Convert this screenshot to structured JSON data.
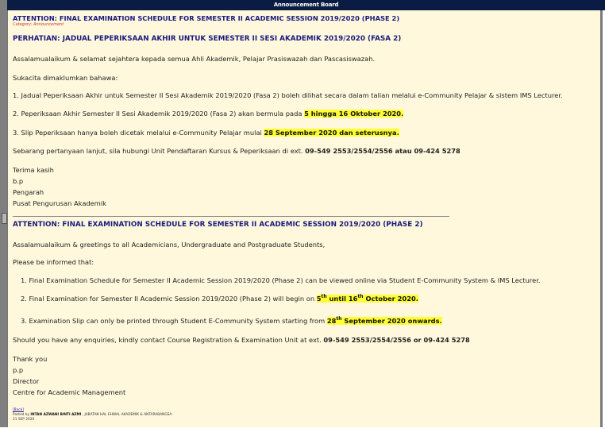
{
  "board_title": "Announcement Board",
  "category": "Category: Announcement",
  "heading": "ATTENTION: FINAL EXAMINATION SCHEDULE FOR SEMESTER II ACADEMIC SESSION 2019/2020 (PHASE 2)",
  "malay": {
    "title": "PERHATIAN: JADUAL PEPERIKSAAN AKHIR UNTUK SEMESTER II SESI AKADEMIK 2019/2020 (FASA 2)",
    "greeting": "Assalamualaikum & selamat sejahtera kepada semua Ahli Akademik, Pelajar Prasiswazah dan Pascasiswazah.",
    "intro": "Sukacita dimaklumkan bahawa:",
    "item1": "1. Jadual Peperiksaan Akhir untuk Semester II Sesi Akademik 2019/2020 (Fasa 2) boleh dilihat secara dalam talian melalui e-Community Pelajar & sistem IMS Lecturer.",
    "item2_pre": "2. Peperiksaan Akhir Semester II Sesi Akademik 2019/2020 (Fasa 2) akan bermula pada ",
    "item2_hl": "5 hingga 16 Oktober 2020.",
    "item3_pre": "3. Slip Peperiksaan hanya boleh dicetak melalui e-Community Pelajar mulai ",
    "item3_hl": "28 September 2020 dan seterusnya.",
    "contact_pre": "Sebarang pertanyaan lanjut, sila hubungi Unit Pendaftaran Kursus & Peperiksaan di ext. ",
    "contact_num": "09-549 2553/2554/2556 atau 09-424 5278",
    "thanks": "Terima kasih",
    "bp": "b.p",
    "role": "Pengarah",
    "dept": "Pusat Pengurusan Akademik"
  },
  "english": {
    "title": "ATTENTION: FINAL EXAMINATION SCHEDULE FOR SEMESTER II ACADEMIC SESSION 2019/2020 (PHASE 2)",
    "greeting": "Assalamualaikum & greetings to all Academicians, Undergraduate and Postgraduate Students,",
    "intro": "Please be informed that:",
    "item1": "1. Final Examination Schedule for Semester II Academic Session 2019/2020 (Phase 2) can be viewed online via Student E-Community System & IMS Lecturer.",
    "item2_pre": "2. Final Examination for Semester II Academic Session 2019/2020 (Phase 2) will begin on ",
    "item2_hl_a": "5",
    "item2_sup_a": "th",
    "item2_hl_b": " until 16",
    "item2_sup_b": "th",
    "item2_hl_c": " October 2020.",
    "item3_pre": "3.  Examination Slip can only be printed through Student E-Community System starting from ",
    "item3_hl_a": "28",
    "item3_sup": "th",
    "item3_hl_b": " September 2020 onwards.",
    "contact_pre": "Should you have any enquiries, kindly contact Course Registration & Examination Unit at ext. ",
    "contact_num": "09-549 2553/2554/2556 or 09-424 5278",
    "thanks": "Thank you",
    "pp": "p.p",
    "role": "Director",
    "dept": "Centre for Academic Management"
  },
  "footer": {
    "back": "[Back]",
    "posted_pre": "Posted by ",
    "author": "INTAN AZWANI BINTI AZMI",
    "posted_post": " , JABATAN HAL EHWAL AKADEMIK & ANTARABANGSA",
    "date": "21 SEP 2020"
  }
}
